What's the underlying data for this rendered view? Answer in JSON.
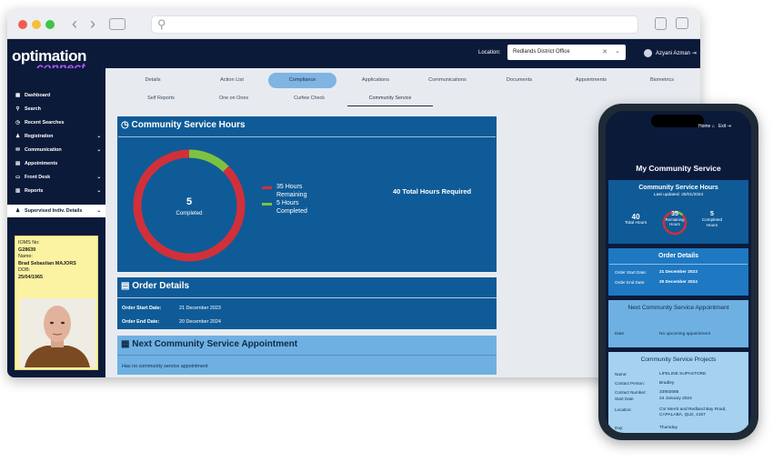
{
  "app": {
    "logo_line1": "optimation",
    "logo_line2": "connect"
  },
  "topbar": {
    "location_label": "Location:",
    "location_value": "Redlands District Office",
    "user_name": "Azyani Azman"
  },
  "sidebar": {
    "items": [
      {
        "label": "Dashboard",
        "icon": "dashboard-icon"
      },
      {
        "label": "Search",
        "icon": "search-icon"
      },
      {
        "label": "Recent Searches",
        "icon": "clock-icon"
      },
      {
        "label": "Registration",
        "icon": "user-add-icon"
      },
      {
        "label": "Communication",
        "icon": "chat-icon"
      },
      {
        "label": "Appointments",
        "icon": "calendar-icon"
      },
      {
        "label": "Front Desk",
        "icon": "desk-icon"
      },
      {
        "label": "Reports",
        "icon": "report-icon"
      },
      {
        "label": "Supervised Indiv. Details",
        "icon": "person-icon"
      }
    ]
  },
  "person": {
    "ioms_label": "IOMS No:",
    "ioms": "G28639",
    "name_label": "Name:",
    "name": "Brad Sebastian MAJORS",
    "dob_label": "DOB:",
    "dob": "25/04/1965"
  },
  "tabs": [
    "Details",
    "Action List",
    "Compliance",
    "Applications",
    "Communications",
    "Documents",
    "Appointments",
    "Biometrics"
  ],
  "subtabs": [
    "Self Reports",
    "One on Ones",
    "Curfew Check",
    "Community Service"
  ],
  "hours_panel": {
    "title": "Community Service Hours",
    "center_value": "5",
    "center_label": "Completed",
    "legend_remaining": "35 Hours Remaining",
    "legend_completed": "5 Hours Completed",
    "total_required": "40 Total Hours Required",
    "completed": 5,
    "total": 40,
    "color_remaining": "#d1303a",
    "color_completed": "#7cc242"
  },
  "order_panel": {
    "title": "Order Details",
    "start_label": "Order Start Date:",
    "start": "21 December 2023",
    "end_label": "Order End Date:",
    "end": "20 December 2024"
  },
  "appt_panel": {
    "title": "Next Community Service Appointment",
    "text": "Has no community service appointment"
  },
  "mobile": {
    "home": "Home",
    "exit": "Exit",
    "title": "My Community Service",
    "hours_title": "Community Service Hours",
    "updated_label": "Last updated:",
    "updated": "25/01/2024",
    "total_value": "40",
    "total_label": "Total Hours",
    "remaining_value": "35",
    "remaining_label": "Remaining Hours",
    "completed_value": "5",
    "completed_label": "Completed Hours",
    "order_title": "Order Details",
    "start_label": "Order Start Date:",
    "start": "21 December 2023",
    "end_label": "Order End Date:",
    "end": "20 December 2024",
    "appt_title": "Next Community Service Appointment",
    "appt_date_label": "Date",
    "appt_date": "No upcoming appointment",
    "projects_title": "Community Service Projects",
    "project": [
      {
        "label": "Name:",
        "value": "LIFELINE SUPASTORE"
      },
      {
        "label": "Contact Person:",
        "value": "Bradley"
      },
      {
        "label": "Contact Number:",
        "value": "33902685"
      },
      {
        "label": "Start Date",
        "value": "24 January 2024"
      },
      {
        "label": "Location:",
        "value": "Cnr Merrit and Redland Bay Road, CAPALABA, QLD, 4157"
      },
      {
        "label": "Day:",
        "value": "Thursday"
      }
    ]
  }
}
